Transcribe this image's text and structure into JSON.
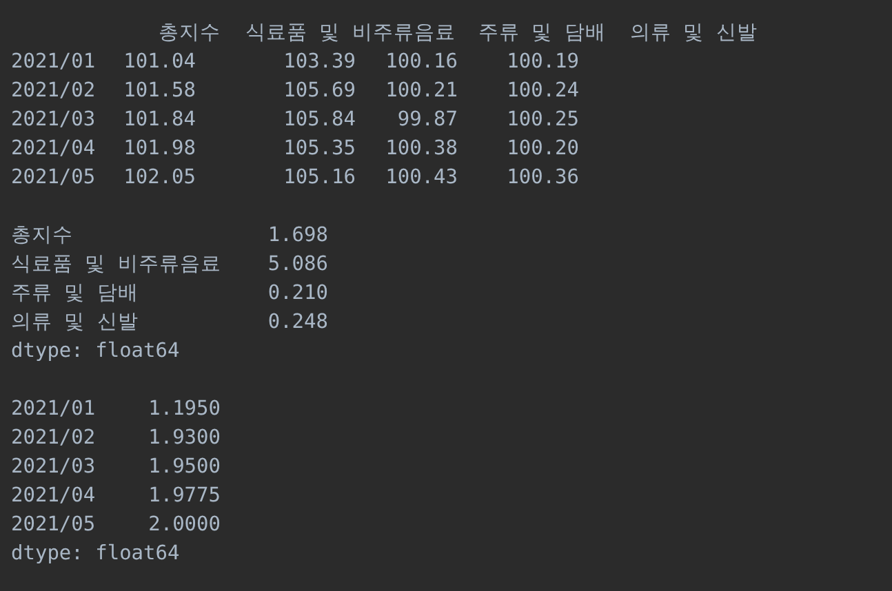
{
  "table": {
    "columns": [
      "총지수",
      "식료품 및 비주류음료",
      "주류 및 담배",
      "의류 및 신발"
    ],
    "rows": [
      {
        "index": "2021/01",
        "values": [
          "101.04",
          "103.39",
          "100.16",
          "100.19"
        ]
      },
      {
        "index": "2021/02",
        "values": [
          "101.58",
          "105.69",
          "100.21",
          "100.24"
        ]
      },
      {
        "index": "2021/03",
        "values": [
          "101.84",
          "105.84",
          "99.87",
          "100.25"
        ]
      },
      {
        "index": "2021/04",
        "values": [
          "101.98",
          "105.35",
          "100.38",
          "100.20"
        ]
      },
      {
        "index": "2021/05",
        "values": [
          "102.05",
          "105.16",
          "100.43",
          "100.36"
        ]
      }
    ]
  },
  "series_1": {
    "rows": [
      {
        "label": "총지수",
        "value": "1.698"
      },
      {
        "label": "식료품 및 비주류음료",
        "value": "5.086"
      },
      {
        "label": "주류 및 담배",
        "value": "0.210"
      },
      {
        "label": "의류 및 신발",
        "value": "0.248"
      }
    ],
    "dtype": "dtype: float64"
  },
  "series_2": {
    "rows": [
      {
        "label": "2021/01",
        "value": "1.1950"
      },
      {
        "label": "2021/02",
        "value": "1.9300"
      },
      {
        "label": "2021/03",
        "value": "1.9500"
      },
      {
        "label": "2021/04",
        "value": "1.9775"
      },
      {
        "label": "2021/05",
        "value": "2.0000"
      }
    ],
    "dtype": "dtype: float64"
  }
}
